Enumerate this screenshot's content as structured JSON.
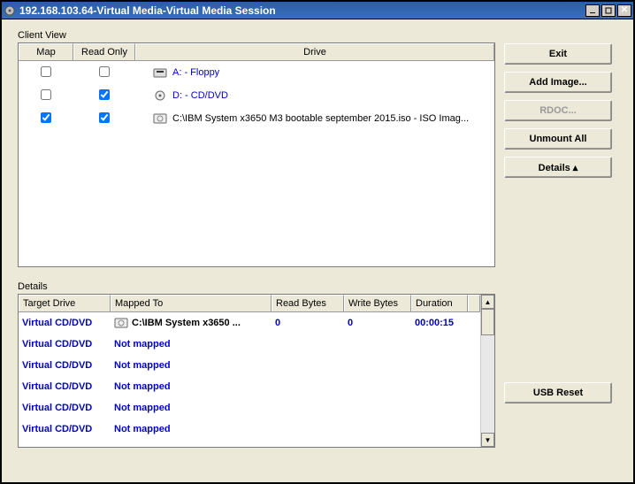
{
  "window": {
    "title": "192.168.103.64-Virtual Media-Virtual Media Session"
  },
  "clientView": {
    "label": "Client View",
    "headers": {
      "map": "Map",
      "readOnly": "Read Only",
      "drive": "Drive"
    },
    "rows": [
      {
        "map": false,
        "readOnly": false,
        "readOnlyDisabled": false,
        "icon": "floppy",
        "label": "A: - Floppy",
        "link": true
      },
      {
        "map": false,
        "readOnly": true,
        "readOnlyDisabled": false,
        "icon": "cd",
        "label": "D: - CD/DVD",
        "link": true
      },
      {
        "map": true,
        "readOnly": true,
        "readOnlyDisabled": false,
        "icon": "iso",
        "label": "C:\\IBM System x3650 M3 bootable september 2015.iso - ISO Imag...",
        "link": false
      }
    ]
  },
  "buttons": {
    "exit": "Exit",
    "addImage": "Add Image...",
    "rdoc": "RDOC...",
    "unmountAll": "Unmount All",
    "details": "Details ▴",
    "usbReset": "USB Reset"
  },
  "details": {
    "label": "Details",
    "headers": {
      "target": "Target Drive",
      "mapped": "Mapped To",
      "read": "Read Bytes",
      "write": "Write Bytes",
      "duration": "Duration"
    },
    "rows": [
      {
        "target": "Virtual CD/DVD",
        "mapped": "C:\\IBM System x3650 ...",
        "mappedIcon": true,
        "read": "0",
        "write": "0",
        "duration": "00:00:15"
      },
      {
        "target": "Virtual CD/DVD",
        "mapped": "Not mapped",
        "mappedIcon": false,
        "read": "",
        "write": "",
        "duration": ""
      },
      {
        "target": "Virtual CD/DVD",
        "mapped": "Not mapped",
        "mappedIcon": false,
        "read": "",
        "write": "",
        "duration": ""
      },
      {
        "target": "Virtual CD/DVD",
        "mapped": "Not mapped",
        "mappedIcon": false,
        "read": "",
        "write": "",
        "duration": ""
      },
      {
        "target": "Virtual CD/DVD",
        "mapped": "Not mapped",
        "mappedIcon": false,
        "read": "",
        "write": "",
        "duration": ""
      },
      {
        "target": "Virtual CD/DVD",
        "mapped": "Not mapped",
        "mappedIcon": false,
        "read": "",
        "write": "",
        "duration": ""
      }
    ]
  }
}
